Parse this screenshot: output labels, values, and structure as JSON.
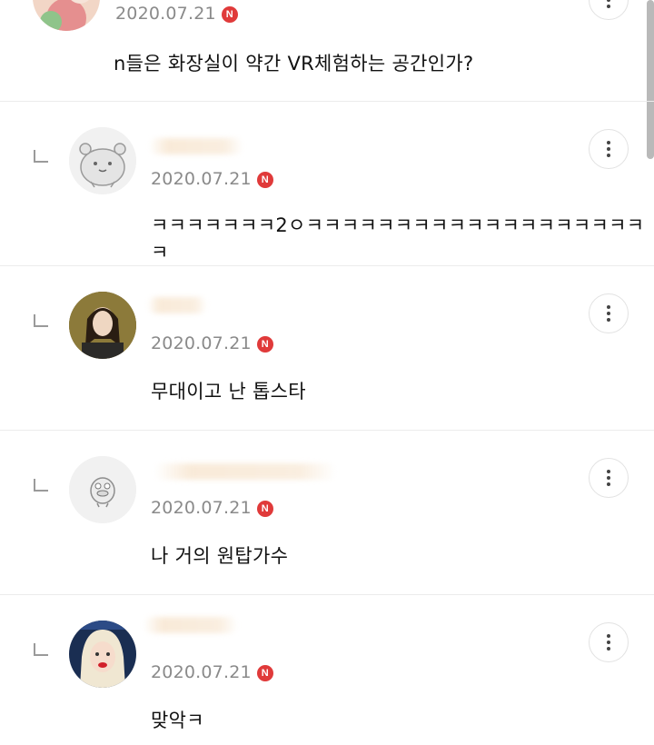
{
  "comments": [
    {
      "date": "2020.07.21",
      "badge": "N",
      "text": "n들은 화장실이 약간 VR체험하는 공간인가?",
      "is_reply": false,
      "avatar": "photo-avatar-pink"
    },
    {
      "date": "2020.07.21",
      "badge": "N",
      "text": "ㅋㅋㅋㅋㅋㅋㅋ2ㅇㅋㅋㅋㅋㅋㅋㅋㅋㅋㅋㅋㅋㅋㅋㅋㅋㅋㅋㅋㅋ",
      "is_reply": true,
      "avatar": "hamster-avatar"
    },
    {
      "date": "2020.07.21",
      "badge": "N",
      "text": "무대이고 난 톱스타",
      "is_reply": true,
      "avatar": "photo-avatar-portrait"
    },
    {
      "date": "2020.07.21",
      "badge": "N",
      "text": "나 거의 원탑가수",
      "is_reply": true,
      "avatar": "duck-avatar"
    },
    {
      "date": "2020.07.21",
      "badge": "N",
      "text": "맞악ㅋ",
      "is_reply": true,
      "avatar": "photo-avatar-red-lips"
    }
  ],
  "colors": {
    "badge": "#e03a3a",
    "date": "#8a8a8a",
    "divider": "#ececec"
  }
}
